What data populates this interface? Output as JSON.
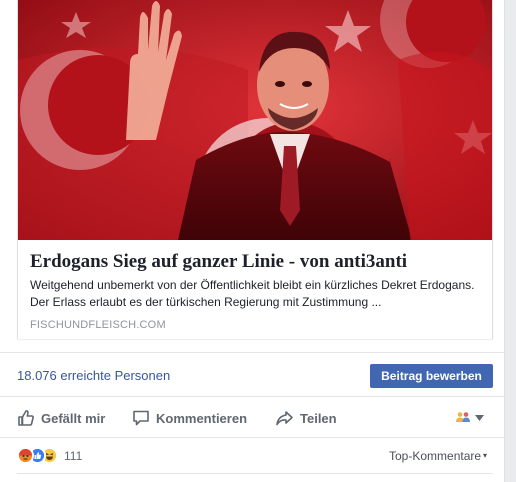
{
  "link_card": {
    "image_alt": "Recep Tayyip Erdoğan waving in front of Turkish flags",
    "title": "Erdogans Sieg auf ganzer Linie - von anti3anti",
    "description": "Weitgehend unbemerkt von der Öffentlichkeit bleibt ein kürzliches Dekret Erdogans. Der Erlass erlaubt es der türkischen Regierung mit Zustimmung ...",
    "domain": "FISCHUNDFLEISCH.COM"
  },
  "insights": {
    "reach_label": "18.076 erreichte Personen",
    "promote_label": "Beitrag bewerben"
  },
  "actions": {
    "like_label": "Gefällt mir",
    "comment_label": "Kommentieren",
    "share_label": "Teilen",
    "audience_icon": "friends-icon"
  },
  "reactions": {
    "icons": [
      "angry-reaction-icon",
      "like-reaction-icon",
      "haha-reaction-icon"
    ],
    "count": "111",
    "sort_label": "Top-Kommentare"
  },
  "colors": {
    "link": "#365899",
    "button": "#4267b2",
    "flag_red": "#c8141e"
  }
}
